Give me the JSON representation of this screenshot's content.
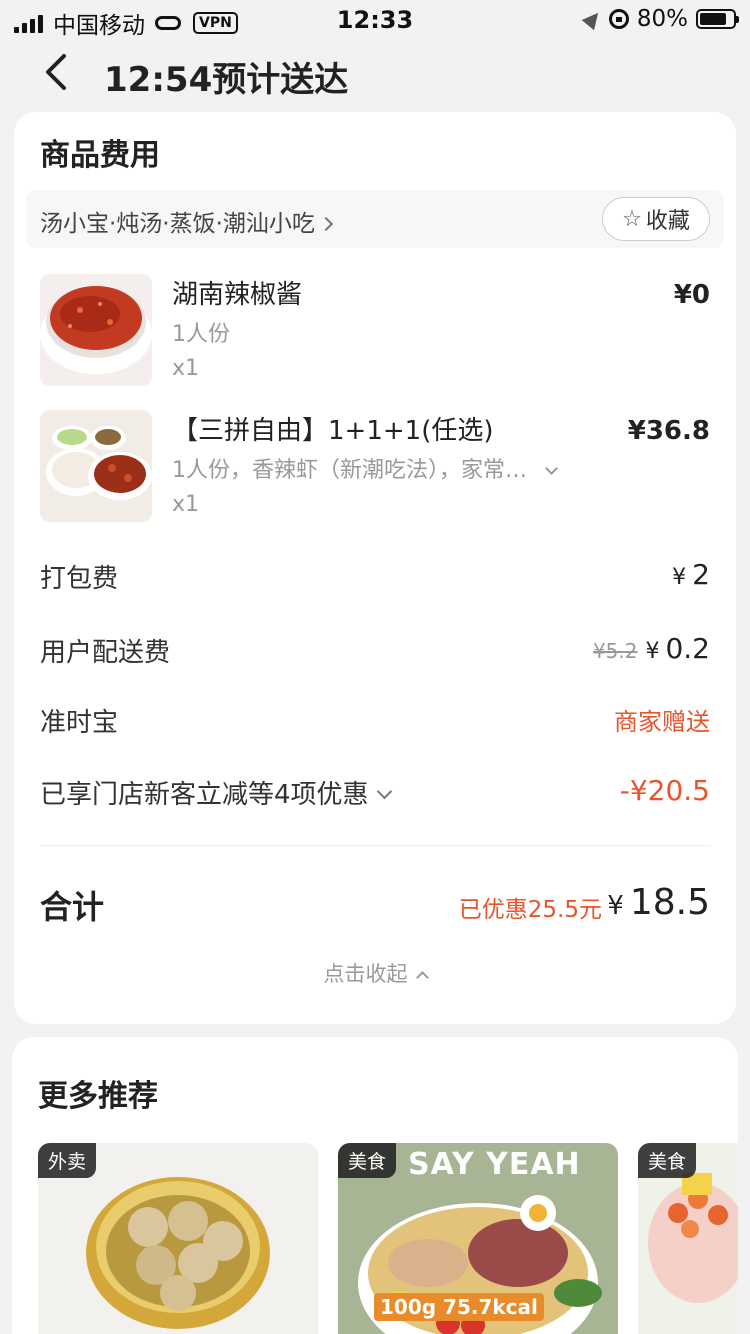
{
  "status_bar": {
    "carrier": "中国移动",
    "vpn": "VPN",
    "time": "12:33",
    "battery": "80%",
    "battery_level": 0.8
  },
  "nav": {
    "title": "12:54预计送达",
    "back_icon": "chevron-left-icon"
  },
  "order": {
    "section_title": "商品费用",
    "shop": {
      "name": "汤小宝·炖汤·蒸饭·潮汕小吃",
      "fav_label": "收藏",
      "fav_icon": "star-outline-icon"
    },
    "items": [
      {
        "name": "湖南辣椒酱",
        "spec": "1人份",
        "qty": "x1",
        "price": "¥0"
      },
      {
        "name": "【三拼自由】1+1+1(任选)",
        "spec": "1人份，香辣虾（新潮吃法），家常…",
        "qty": "x1",
        "price": "¥36.8"
      }
    ],
    "fees": {
      "packing": {
        "label": "打包费",
        "yen": "¥",
        "value": "2"
      },
      "delivery": {
        "label": "用户配送费",
        "original": "¥5.2",
        "yen": "¥",
        "value": "0.2"
      },
      "ontime": {
        "label": "准时宝",
        "value": "商家赠送"
      },
      "discount": {
        "label": "已享门店新客立减等4项优惠",
        "value": "-¥20.5"
      }
    },
    "total": {
      "label": "合计",
      "saved": "已优惠25.5元",
      "yen": "¥",
      "value": "18.5"
    },
    "collapse_label": "点击收起"
  },
  "recommend": {
    "title": "更多推荐",
    "tiles": [
      {
        "tag": "外卖"
      },
      {
        "tag": "美食",
        "banner": "SAY YEAH",
        "kcal": "100g 75.7kcal"
      },
      {
        "tag": "美食"
      }
    ]
  },
  "colors": {
    "accent_red": "#e8542b",
    "background": "#f2f2f2"
  }
}
